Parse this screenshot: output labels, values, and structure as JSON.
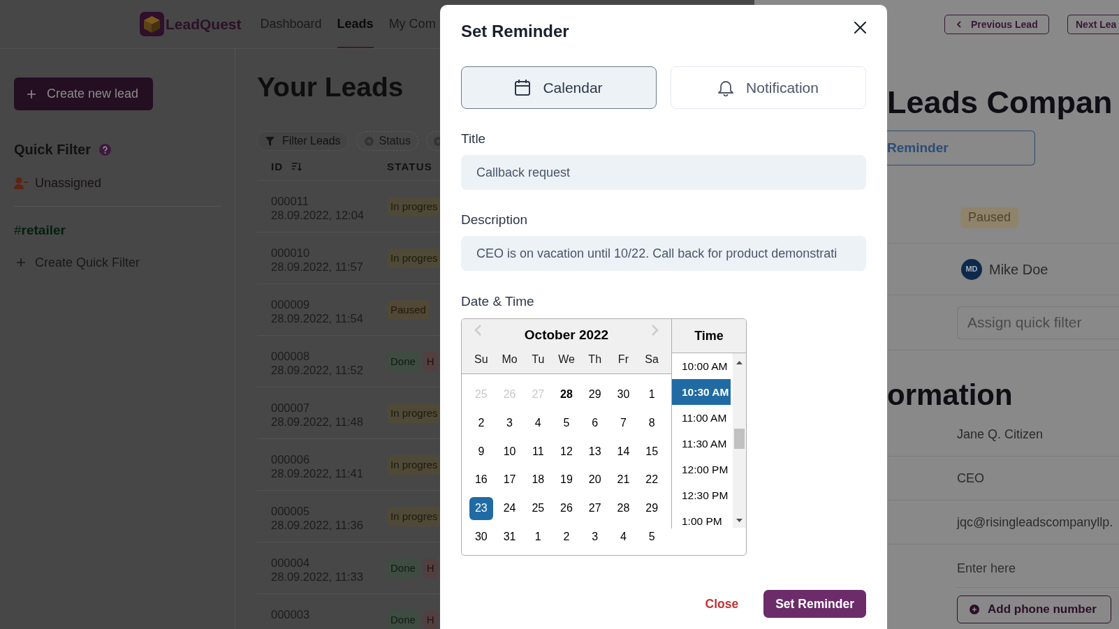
{
  "nav": {
    "logo": "LeadQuest",
    "items": [
      {
        "label": "Dashboard",
        "selected": false
      },
      {
        "label": "Leads",
        "selected": true
      },
      {
        "label": "My Com",
        "selected": false
      }
    ]
  },
  "sidebar": {
    "create_button": "Create new lead",
    "quick_filter": {
      "title": "Quick Filter",
      "items": [
        {
          "kind": "user",
          "label": "Unassigned"
        },
        {
          "kind": "tag",
          "label": "#**retailer**"
        }
      ],
      "create_button": "Create Quick Filter"
    }
  },
  "leads": {
    "title": "Your Leads",
    "filters": [
      {
        "kind": "filter",
        "label": "Filter Leads"
      },
      {
        "kind": "add",
        "label": "Status"
      },
      {
        "kind": "add"
      }
    ],
    "columns": [
      {
        "label": "ID",
        "sortable": true
      },
      {
        "label": "STATUS",
        "sortable": false
      }
    ],
    "rows": [
      {
        "id": "000011",
        "created": "28.09.2022, 12:04",
        "badges": [
          {
            "label": "In progres",
            "color": "#4f4a37"
          }
        ]
      },
      {
        "id": "000010",
        "created": "28.09.2022, 11:57",
        "badges": [
          {
            "label": "In progres",
            "color": "#4f4a37"
          }
        ]
      },
      {
        "id": "000009",
        "created": "28.09.2022, 11:54",
        "badges": [
          {
            "label": "Paused",
            "color": "#524836"
          }
        ]
      },
      {
        "id": "000008",
        "created": "28.09.2022, 11:52",
        "badges": [
          {
            "label": "Done",
            "color": "#3e4c41"
          },
          {
            "label": "H",
            "color": "#523f40"
          }
        ]
      },
      {
        "id": "000007",
        "created": "28.09.2022, 11:48",
        "badges": [
          {
            "label": "In progres",
            "color": "#4f4a37"
          }
        ]
      },
      {
        "id": "000006",
        "created": "28.09.2022, 11:41",
        "badges": [
          {
            "label": "In progres",
            "color": "#4f4a37"
          }
        ]
      },
      {
        "id": "000005",
        "created": "28.09.2022, 11:36",
        "badges": [
          {
            "label": "In progres",
            "color": "#4f4a37"
          }
        ]
      },
      {
        "id": "000004",
        "created": "28.09.2022, 11:33",
        "badges": [
          {
            "label": "Done",
            "color": "#3e4c41"
          },
          {
            "label": "H",
            "color": "#523f40"
          }
        ]
      },
      {
        "id": "000003",
        "badges": [
          {
            "label": "Done",
            "color": "#3e4c41"
          },
          {
            "label": "H",
            "color": "#523f40"
          }
        ]
      }
    ]
  },
  "modal": {
    "title": "Set Reminder",
    "tabs": [
      {
        "kind": "calendar",
        "label": "Calendar",
        "selected": true
      },
      {
        "kind": "bell",
        "label": "Notification",
        "selected": false
      }
    ],
    "fields": [
      {
        "label": "Title",
        "value": "Callback request"
      },
      {
        "label": "Description",
        "value": "CEO is on vacation until 10/22. Call back for product demonstrati"
      }
    ],
    "datetime": {
      "label": "Date & Time",
      "month": "October 2022",
      "weekdays": [
        "Su",
        "Mo",
        "Tu",
        "We",
        "Th",
        "Fr",
        "Sa"
      ],
      "days": [
        {
          "label": "25",
          "disabled": true,
          "today": false,
          "selected": false
        },
        {
          "label": "26",
          "disabled": true,
          "today": false,
          "selected": false
        },
        {
          "label": "27",
          "disabled": true,
          "today": false,
          "selected": false
        },
        {
          "label": "28",
          "disabled": false,
          "today": true,
          "selected": false
        },
        {
          "label": "29",
          "disabled": false,
          "today": false,
          "selected": false
        },
        {
          "label": "30",
          "disabled": false,
          "today": false,
          "selected": false
        },
        {
          "label": "1",
          "disabled": false,
          "today": false,
          "selected": false
        },
        {
          "label": "2",
          "disabled": false,
          "today": false,
          "selected": false
        },
        {
          "label": "3",
          "disabled": false,
          "today": false,
          "selected": false
        },
        {
          "label": "4",
          "disabled": false,
          "today": false,
          "selected": false
        },
        {
          "label": "5",
          "disabled": false,
          "today": false,
          "selected": false
        },
        {
          "label": "6",
          "disabled": false,
          "today": false,
          "selected": false
        },
        {
          "label": "7",
          "disabled": false,
          "today": false,
          "selected": false
        },
        {
          "label": "8",
          "disabled": false,
          "today": false,
          "selected": false
        },
        {
          "label": "9",
          "disabled": false,
          "today": false,
          "selected": false
        },
        {
          "label": "10",
          "disabled": false,
          "today": false,
          "selected": false
        },
        {
          "label": "11",
          "disabled": false,
          "today": false,
          "selected": false
        },
        {
          "label": "12",
          "disabled": false,
          "today": false,
          "selected": false
        },
        {
          "label": "13",
          "disabled": false,
          "today": false,
          "selected": false
        },
        {
          "label": "14",
          "disabled": false,
          "today": false,
          "selected": false
        },
        {
          "label": "15",
          "disabled": false,
          "today": false,
          "selected": false
        },
        {
          "label": "16",
          "disabled": false,
          "today": false,
          "selected": false
        },
        {
          "label": "17",
          "disabled": false,
          "today": false,
          "selected": false
        },
        {
          "label": "18",
          "disabled": false,
          "today": false,
          "selected": false
        },
        {
          "label": "19",
          "disabled": false,
          "today": false,
          "selected": false
        },
        {
          "label": "20",
          "disabled": false,
          "today": false,
          "selected": false
        },
        {
          "label": "21",
          "disabled": false,
          "today": false,
          "selected": false
        },
        {
          "label": "22",
          "disabled": false,
          "today": false,
          "selected": false
        },
        {
          "label": "23",
          "disabled": false,
          "today": false,
          "selected": true
        },
        {
          "label": "24",
          "disabled": false,
          "today": false,
          "selected": false
        },
        {
          "label": "25",
          "disabled": false,
          "today": false,
          "selected": false
        },
        {
          "label": "26",
          "disabled": false,
          "today": false,
          "selected": false
        },
        {
          "label": "27",
          "disabled": false,
          "today": false,
          "selected": false
        },
        {
          "label": "28",
          "disabled": false,
          "today": false,
          "selected": false
        },
        {
          "label": "29",
          "disabled": false,
          "today": false,
          "selected": false
        },
        {
          "label": "30",
          "disabled": false,
          "today": false,
          "selected": false
        },
        {
          "label": "31",
          "disabled": false,
          "today": false,
          "selected": false
        },
        {
          "label": "1",
          "disabled": false,
          "today": false,
          "selected": false
        },
        {
          "label": "2",
          "disabled": false,
          "today": false,
          "selected": false
        },
        {
          "label": "3",
          "disabled": false,
          "today": false,
          "selected": false
        },
        {
          "label": "4",
          "disabled": false,
          "today": false,
          "selected": false
        },
        {
          "label": "5",
          "disabled": false,
          "today": false,
          "selected": false
        }
      ],
      "time": {
        "title": "Time",
        "slots": [
          {
            "label": "10:00 AM",
            "selected": false
          },
          {
            "label": "10:30 AM",
            "selected": true
          },
          {
            "label": "11:00 AM",
            "selected": false
          },
          {
            "label": "11:30 AM",
            "selected": false
          },
          {
            "label": "12:00 PM",
            "selected": false
          },
          {
            "label": "12:30 PM",
            "selected": false
          },
          {
            "label": "1:00 PM",
            "selected": false
          }
        ]
      }
    },
    "buttons": [
      {
        "kind": "text",
        "label": "Close"
      },
      {
        "kind": "primary",
        "label": "Set Reminder"
      }
    ]
  },
  "detail": {
    "nav_buttons": [
      {
        "kind": "previous",
        "label": "Previous Lead"
      },
      {
        "kind": "next",
        "label": "Next Lea"
      }
    ],
    "title": "Leads Compan",
    "reminder_button": "Reminder",
    "rows": [
      {
        "kind": "badge",
        "label": "Paused",
        "color": "#8f836c"
      },
      {
        "kind": "user",
        "initials": "MD",
        "label": "Mike Doe"
      },
      {
        "kind": "input",
        "placeholder": "Assign quick filter"
      }
    ],
    "section_title": "ormation",
    "contact_rows": [
      {
        "kind": "text",
        "label": "Jane Q. Citizen"
      },
      {
        "kind": "text",
        "label": "CEO"
      },
      {
        "kind": "text",
        "label": "jqc@risingleadscompanyllp."
      },
      {
        "kind": "input",
        "placeholder": "Enter here"
      }
    ],
    "add_button": "Add phone number"
  }
}
